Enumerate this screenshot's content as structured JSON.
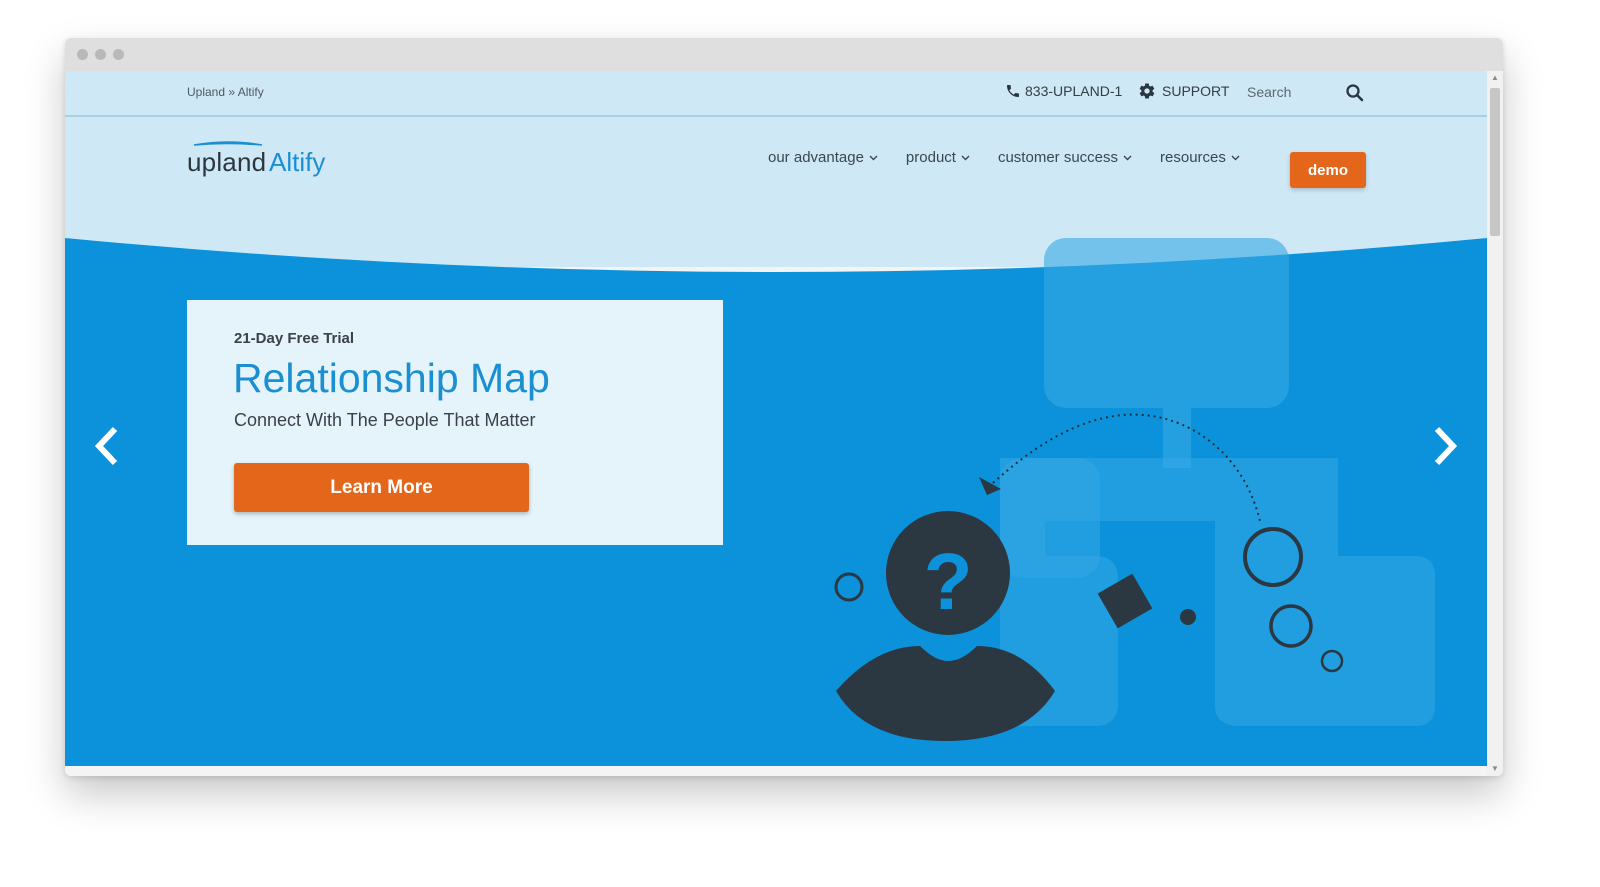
{
  "breadcrumb": {
    "home": "Upland",
    "separator": "»",
    "current": "Altify"
  },
  "utility": {
    "phone": "833-UPLAND-1",
    "support": "SUPPORT",
    "search_placeholder": "Search"
  },
  "logo": {
    "brand": "upland",
    "product": "Altify"
  },
  "nav": {
    "items": [
      {
        "label": "our advantage"
      },
      {
        "label": "product"
      },
      {
        "label": "customer success"
      },
      {
        "label": "resources"
      }
    ],
    "demo_label": "demo"
  },
  "hero": {
    "eyebrow": "21-Day Free Trial",
    "title": "Relationship Map",
    "subtitle": "Connect With The People That Matter",
    "cta": "Learn More"
  },
  "colors": {
    "light_blue": "#cfe8f6",
    "hero_blue": "#0b92da",
    "accent_orange": "#e4661b",
    "brand_blue": "#1a8fd1",
    "dark": "#2b3740"
  },
  "icons": [
    "phone-icon",
    "gear-icon",
    "search-icon",
    "chevron-down-icon",
    "chevron-left-icon",
    "chevron-right-icon"
  ]
}
